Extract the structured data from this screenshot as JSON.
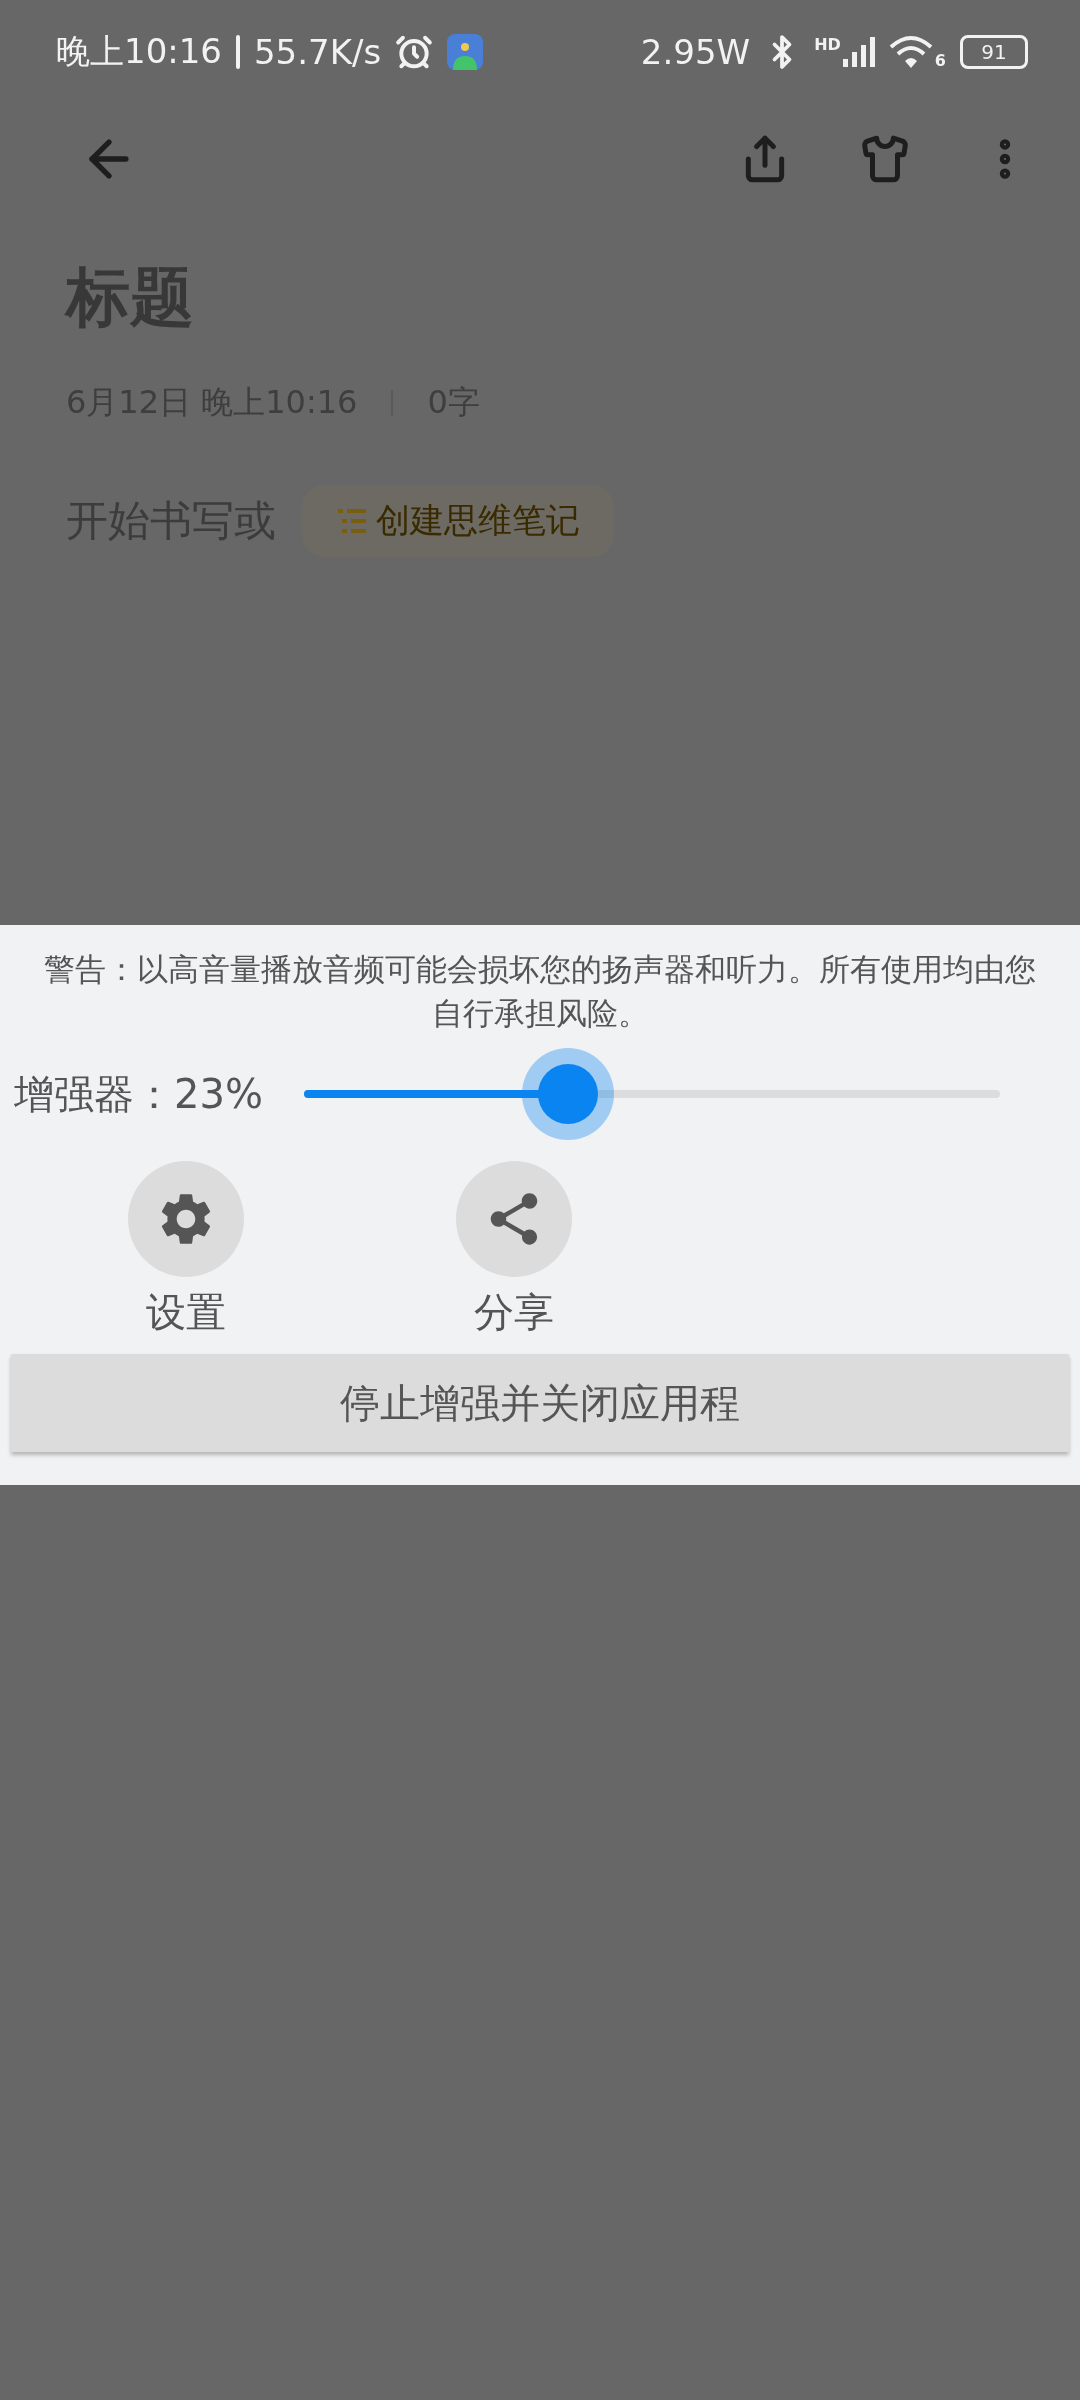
{
  "status_bar": {
    "time": "晚上10:16",
    "speed": "55.7K/s",
    "power": "2.95W",
    "signal_label": "HD",
    "wifi_label": "6",
    "battery": "91"
  },
  "note": {
    "title": "标题",
    "date": "6月12日 晚上10:16",
    "word_count": "0字",
    "prompt": "开始书写或",
    "mind_note_button": "创建思维笔记"
  },
  "panel": {
    "warning": "警告：以高音量播放音频可能会损坏您的扬声器和听力。所有使用均由您自行承担风险。",
    "booster": {
      "label": "增强器：23%",
      "level": 0.38
    },
    "actions": [
      {
        "kind": "settings",
        "label": "设置"
      },
      {
        "kind": "share",
        "label": "分享"
      }
    ],
    "stop_button": "停止增强并关闭应用程"
  }
}
